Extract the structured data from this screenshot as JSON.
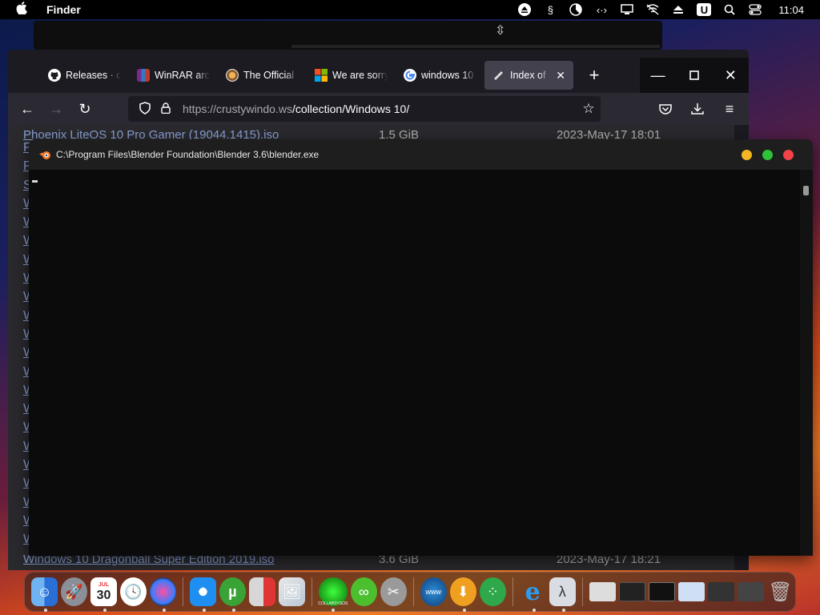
{
  "menubar": {
    "app_name": "Finder",
    "clock": "11:04",
    "status_icons": [
      "eject-icon",
      "script-icon",
      "pie-chart-icon",
      "code-arrows-icon",
      "display-icon",
      "muted-wifi-icon",
      "eject-triangle-icon",
      "u-badge-icon",
      "search-icon",
      "control-center-icon"
    ],
    "u_badge": "U"
  },
  "firefox": {
    "tabs": [
      {
        "label": "Releases · co",
        "icon": "github-icon",
        "color": "#ffffff"
      },
      {
        "label": "WinRAR arch",
        "icon": "winrar-icon",
        "color": "#b33a8a"
      },
      {
        "label": "The Official ",
        "icon": "official-icon",
        "color": "#d28c3c"
      },
      {
        "label": "We are sorry,",
        "icon": "windows-logo-icon",
        "color": "#f25022"
      },
      {
        "label": "windows 10",
        "icon": "google-icon",
        "color": "#4285f4"
      },
      {
        "label": "Index of /c",
        "icon": "page-icon",
        "color": "#cccccc",
        "active": true
      }
    ],
    "url_host": "https://crustywindo.ws",
    "url_path": "/collection/Windows 10/",
    "listing": {
      "first_row": {
        "name": "Phoenix LiteOS 10 Pro Gamer (19044.1415).iso",
        "size": "1.5 GiB",
        "date": "2023-May-17 18:01"
      },
      "last_row": {
        "name": "Windows 10 Dragonball Super Edition 2019.iso",
        "size": "3.6 GiB",
        "date": "2023-May-17 18:21"
      },
      "row_initials": [
        "P",
        "P",
        "S",
        "W",
        "W",
        "W",
        "W",
        "W",
        "W",
        "W",
        "W",
        "W",
        "W",
        "W",
        "W",
        "W",
        "W",
        "W",
        "W",
        "W",
        "W",
        "W"
      ]
    }
  },
  "console": {
    "title": "C:\\Program Files\\Blender Foundation\\Blender 3.6\\blender.exe",
    "light_colors": [
      "#f5b524",
      "#2ec13a",
      "#f2434a"
    ]
  },
  "dock": {
    "calendar_day": "30",
    "calendar_month": "JUL",
    "items": [
      "finder-icon",
      "launchpad-icon",
      "calendar-icon",
      "clock-icon",
      "siri-icon",
      "safari-icon",
      "utorrent-icon",
      "remote-desktop-icon",
      "preview-icon",
      "collabsysos-icon",
      "link-icon",
      "tools-icon",
      "www-icon",
      "download-icon",
      "dots-icon",
      "internet-explorer-icon",
      "lambda-icon",
      "window-thumb-1",
      "window-thumb-2",
      "window-thumb-3",
      "window-thumb-4",
      "window-thumb-5",
      "window-thumb-6",
      "trash-icon"
    ],
    "collab_label": "COLLABSYSOS"
  }
}
